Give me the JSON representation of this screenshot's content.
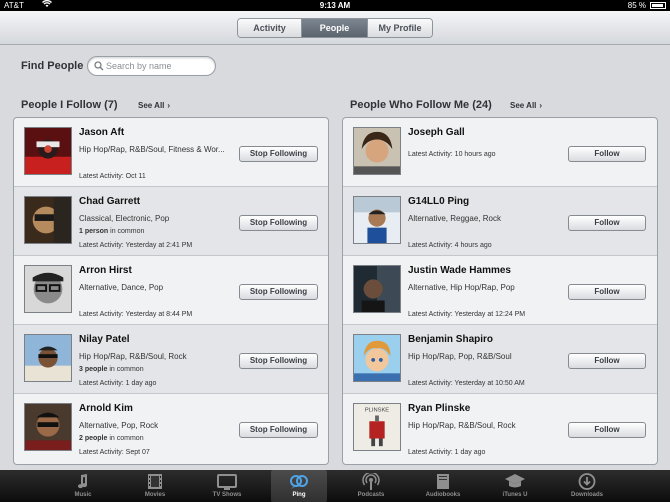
{
  "status_bar": {
    "carrier": "AT&T",
    "time": "9:13 AM",
    "battery": "85 %"
  },
  "segments": [
    {
      "label": "Activity"
    },
    {
      "label": "People"
    },
    {
      "label": "My Profile"
    }
  ],
  "find": {
    "label": "Find People",
    "placeholder": "Search by name"
  },
  "follow_section": {
    "title": "People I Follow (7)",
    "see_all": "See All"
  },
  "followers_section": {
    "title": "People Who Follow Me (24)",
    "see_all": "See All"
  },
  "following": [
    {
      "name": "Jason Aft",
      "genres": "Hip Hop/Rap, R&B/Soul, Fitness & Wor...",
      "common": "",
      "activity": "Latest Activity: Oct 11",
      "button": "Stop Following"
    },
    {
      "name": "Chad Garrett",
      "genres": "Classical, Electronic, Pop",
      "common_count": "1 person",
      "common_suffix": "in common",
      "activity": "Latest Activity: Yesterday at 2:41 PM",
      "button": "Stop Following"
    },
    {
      "name": "Arron Hirst",
      "genres": "Alternative, Dance, Pop",
      "common": "",
      "activity": "Latest Activity: Yesterday at 8:44 PM",
      "button": "Stop Following"
    },
    {
      "name": "Nilay Patel",
      "genres": "Hip Hop/Rap, R&B/Soul, Rock",
      "common_count": "3 people",
      "common_suffix": "in common",
      "activity": "Latest Activity: 1 day ago",
      "button": "Stop Following"
    },
    {
      "name": "Arnold Kim",
      "genres": "Alternative, Pop, Rock",
      "common_count": "2 people",
      "common_suffix": "in common",
      "activity": "Latest Activity: Sept 07",
      "button": "Stop Following"
    }
  ],
  "followers": [
    {
      "name": "Joseph Gall",
      "activity": "Latest Activity: 10 hours ago",
      "button": "Follow"
    },
    {
      "name": "G14LL0 Ping",
      "genres": "Alternative, Reggae, Rock",
      "activity": "Latest Activity: 4 hours ago",
      "button": "Follow"
    },
    {
      "name": "Justin Wade Hammes",
      "genres": "Alternative, Hip Hop/Rap, Pop",
      "activity": "Latest Activity: Yesterday at 12:24 PM",
      "button": "Follow"
    },
    {
      "name": "Benjamin Shapiro",
      "genres": "Hip Hop/Rap, Pop, R&B/Soul",
      "activity": "Latest Activity: Yesterday at 10:50 AM",
      "button": "Follow"
    },
    {
      "name": "Ryan Plinske",
      "genres": "Hip Hop/Rap, R&B/Soul, Rock",
      "activity": "Latest Activity: 1 day ago",
      "button": "Follow",
      "avatar_text": "PLINSKE"
    }
  ],
  "tabs": [
    {
      "label": "Music",
      "icon": "music-note-icon"
    },
    {
      "label": "Movies",
      "icon": "film-icon"
    },
    {
      "label": "TV Shows",
      "icon": "tv-icon"
    },
    {
      "label": "Ping",
      "icon": "ping-icon",
      "active": true
    },
    {
      "label": "Podcasts",
      "icon": "podcast-icon"
    },
    {
      "label": "Audiobooks",
      "icon": "book-icon"
    },
    {
      "label": "iTunes U",
      "icon": "graduation-cap-icon"
    },
    {
      "label": "Downloads",
      "icon": "download-icon"
    }
  ]
}
